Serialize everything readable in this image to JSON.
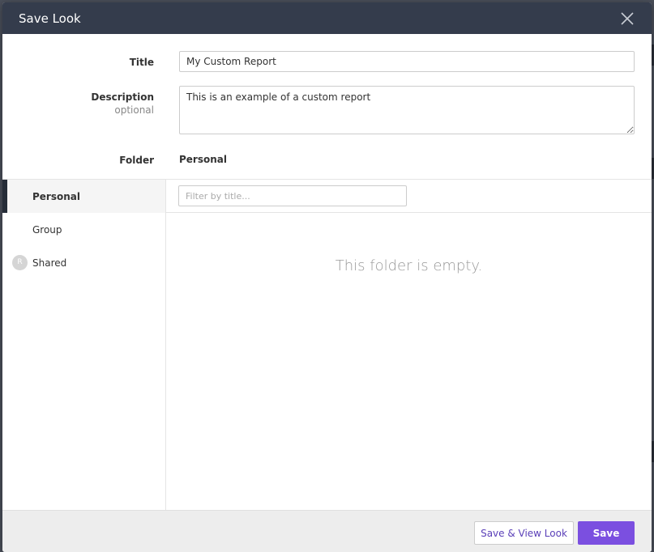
{
  "modal": {
    "title": "Save Look"
  },
  "form": {
    "title_label": "Title",
    "title_value": "My Custom Report",
    "description_label": "Description",
    "description_sublabel": "optional",
    "description_value": "This is an example of a custom report",
    "folder_label": "Folder",
    "folder_value": "Personal"
  },
  "sidebar": {
    "items": [
      {
        "label": "Personal",
        "active": true
      },
      {
        "label": "Group",
        "active": false
      },
      {
        "label": "Shared",
        "active": false,
        "avatar": "R"
      }
    ]
  },
  "content": {
    "filter_placeholder": "Filter by title...",
    "empty_message": "This folder is empty."
  },
  "footer": {
    "save_view_label": "Save & View Look",
    "save_label": "Save"
  },
  "colors": {
    "header_bg": "#343c4c",
    "primary": "#7b4fe0",
    "active_indicator": "#262d38"
  }
}
